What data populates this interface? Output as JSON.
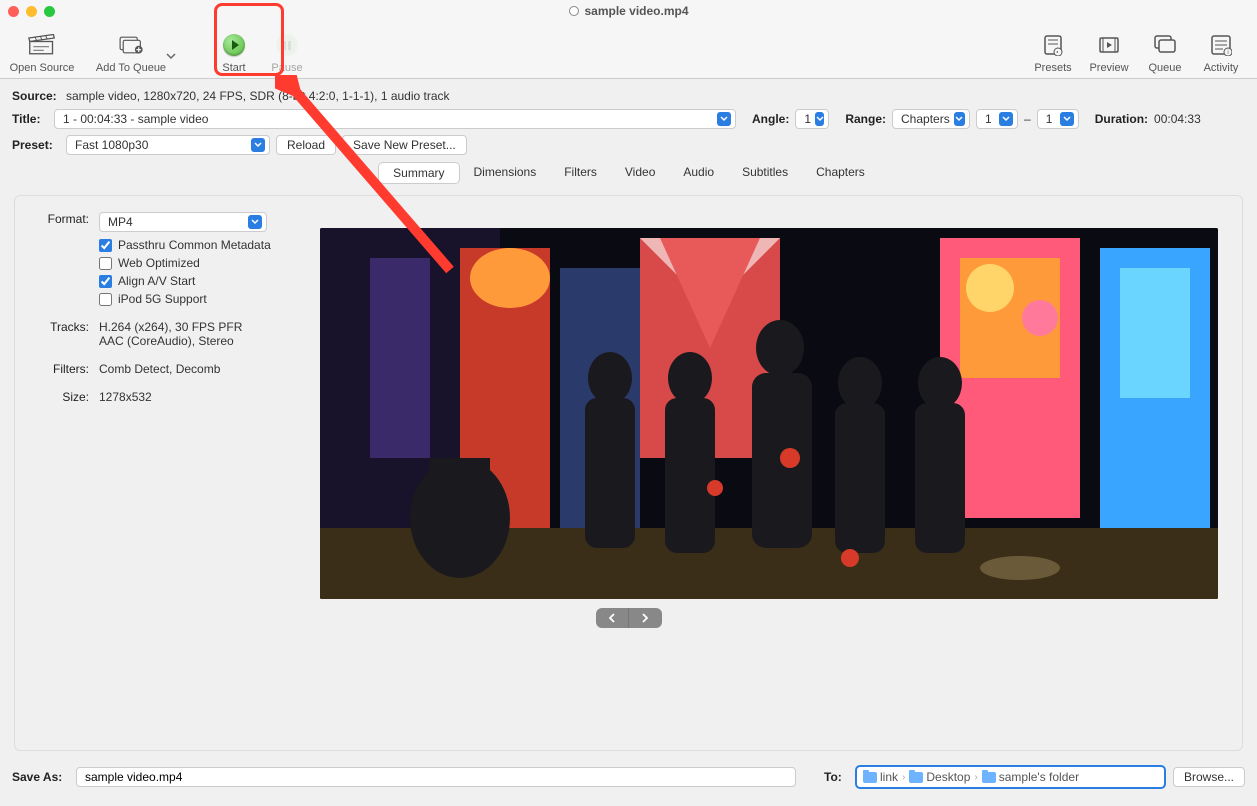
{
  "window": {
    "title": "sample video.mp4"
  },
  "toolbar": {
    "open_source": "Open Source",
    "add_to_queue": "Add To Queue",
    "start": "Start",
    "pause": "Pause",
    "presets": "Presets",
    "preview": "Preview",
    "queue": "Queue",
    "activity": "Activity"
  },
  "source": {
    "label": "Source:",
    "value": "sample video, 1280x720, 24 FPS, SDR (8-bit 4:2:0, 1-1-1), 1 audio track"
  },
  "title": {
    "label": "Title:",
    "value": "1 - 00:04:33 - sample video"
  },
  "angle": {
    "label": "Angle:",
    "value": "1"
  },
  "range": {
    "label": "Range:",
    "mode": "Chapters",
    "from": "1",
    "to": "1",
    "sep": "–"
  },
  "duration": {
    "label": "Duration:",
    "value": "00:04:33"
  },
  "preset": {
    "label": "Preset:",
    "value": "Fast 1080p30",
    "reload": "Reload",
    "save_new": "Save New Preset..."
  },
  "tabs": {
    "summary": "Summary",
    "dimensions": "Dimensions",
    "filters": "Filters",
    "video": "Video",
    "audio": "Audio",
    "subtitles": "Subtitles",
    "chapters": "Chapters"
  },
  "summary": {
    "format_label": "Format:",
    "format_value": "MP4",
    "passthru": "Passthru Common Metadata",
    "web_optimized": "Web Optimized",
    "align_av": "Align A/V Start",
    "ipod": "iPod 5G Support",
    "tracks_label": "Tracks:",
    "tracks_line1": "H.264 (x264), 30 FPS PFR",
    "tracks_line2": "AAC (CoreAudio), Stereo",
    "filters_label": "Filters:",
    "filters_value": "Comb Detect, Decomb",
    "size_label": "Size:",
    "size_value": "1278x532"
  },
  "save": {
    "label": "Save As:",
    "value": "sample video.mp4",
    "to_label": "To:",
    "path": [
      "link",
      "Desktop",
      "sample's folder"
    ],
    "browse": "Browse..."
  }
}
